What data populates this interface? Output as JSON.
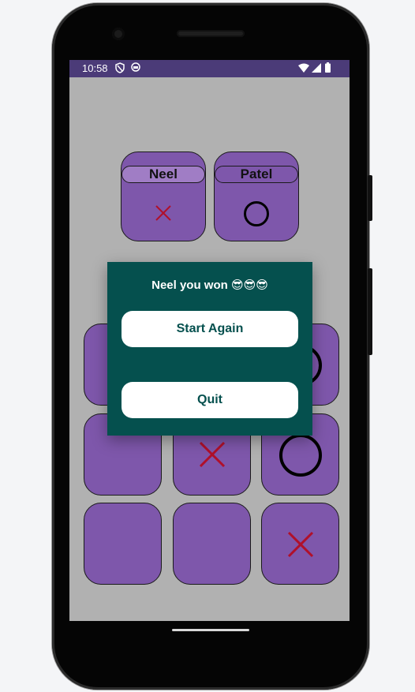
{
  "status_bar": {
    "time": "10:58",
    "left_icons": [
      "shield-icon",
      "face-icon"
    ],
    "right_icons": [
      "wifi-icon",
      "signal-icon",
      "battery-icon"
    ]
  },
  "players": [
    {
      "name": "Neel",
      "symbol": "X",
      "active": true
    },
    {
      "name": "Patel",
      "symbol": "O",
      "active": false
    }
  ],
  "board": [
    [
      "",
      "",
      "O"
    ],
    [
      "",
      "X",
      "O"
    ],
    [
      "",
      "",
      "X"
    ]
  ],
  "dialog": {
    "message": "Neel you won 😎😎😎",
    "start_again_label": "Start Again",
    "quit_label": "Quit"
  },
  "colors": {
    "cell": "#7e57ab",
    "dialog": "#05504e",
    "status_bar": "#4b3b78",
    "x_mark": "#b0102a"
  }
}
